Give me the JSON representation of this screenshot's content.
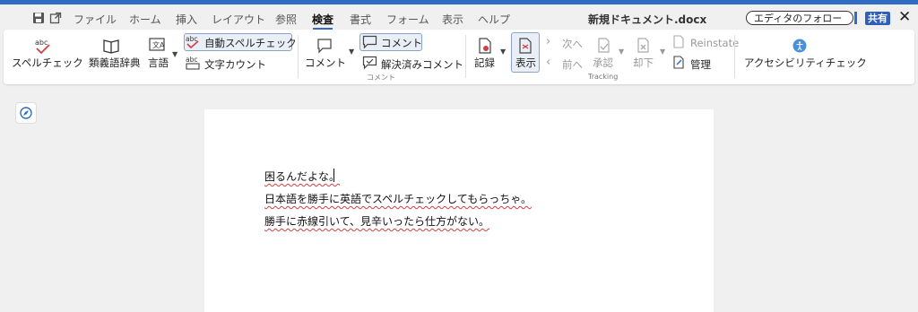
{
  "colors": {
    "accent": "#2f6cc4",
    "share_bg": "#2f5fb8",
    "spell_underline": "#d04040"
  },
  "menubar": {
    "icons": [
      "save-icon",
      "open-external-icon"
    ],
    "items": [
      {
        "label": "ファイル"
      },
      {
        "label": "ホーム"
      },
      {
        "label": "挿入"
      },
      {
        "label": "レイアウト"
      },
      {
        "label": "参照"
      },
      {
        "label": "検査",
        "active": true
      },
      {
        "label": "書式"
      },
      {
        "label": "フォーム"
      },
      {
        "label": "表示"
      },
      {
        "label": "ヘルプ"
      }
    ],
    "doc_title": "新規ドキュメント.docx",
    "follow_label": "エディタのフォロー",
    "share_label": "共有",
    "close_glyph": "✕"
  },
  "ribbon": {
    "spellcheck": "スペルチェック",
    "thesaurus": "類義語辞典",
    "language": "言語",
    "auto_spell": "自動スペルチェック",
    "word_count": "文字カウント",
    "comment_add": "コメント",
    "comment_toggle": "コメント",
    "resolved_comments": "解決済みコメント",
    "comment_group": "コメント",
    "record": "記録",
    "show": "表示",
    "next": "次へ",
    "prev": "前へ",
    "accept": "承認",
    "reject": "却下",
    "reinstate": "Reinstate",
    "manage": "管理",
    "tracking_group": "Tracking",
    "accessibility": "アクセシビリティチェック"
  },
  "document": {
    "lines": [
      "困るんだよな。",
      "日本語を勝手に英語でスペルチェックしてもらっちゃ。",
      "勝手に赤線引いて、見辛いったら仕方がない。"
    ]
  }
}
